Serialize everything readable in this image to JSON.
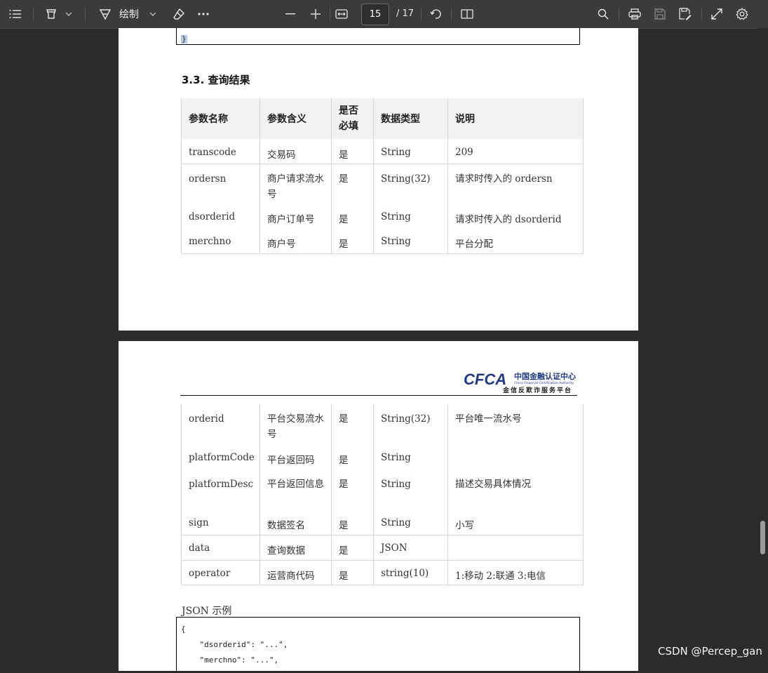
{
  "toolbar": {
    "draw_label": "绘制",
    "page_current": "15",
    "page_total": "/ 17"
  },
  "page1": {
    "brace": "}",
    "section_title": "3.3. 查询结果",
    "headers": [
      "参数名称",
      "参数含义",
      "是否必填",
      "数据类型",
      "说明"
    ],
    "rows": [
      [
        "transcode",
        "交易码",
        "是",
        "String",
        "209"
      ],
      [
        "ordersn",
        "商户请求流水号",
        "是",
        "String(32)",
        "请求时传入的 ordersn"
      ],
      [
        "dsorderid",
        "商户订单号",
        "是",
        "String",
        "请求时传入的 dsorderid"
      ],
      [
        "merchno",
        "商户号",
        "是",
        "String",
        "平台分配"
      ]
    ]
  },
  "page2": {
    "logo_text": "CFCA",
    "logo_cn": "中国金融认证中心",
    "logo_en": "China Financial Certification Authority",
    "logo_sub": "金信反欺诈服务平台",
    "rows": [
      [
        "orderid",
        "平台交易流水号",
        "是",
        "String(32)",
        "平台唯一流水号"
      ],
      [
        "platformCode",
        "平台返回码",
        "是",
        "String",
        ""
      ],
      [
        "platformDesc",
        "平台返回信息",
        "是",
        "String",
        "描述交易具体情况"
      ],
      [
        "sign",
        "数据签名",
        "是",
        "String",
        "小写"
      ],
      [
        "data",
        "查询数据",
        "是",
        "JSON",
        ""
      ],
      [
        "operator",
        "运营商代码",
        "是",
        "string(10)",
        "1:移动 2:联通 3:电信"
      ]
    ],
    "json_label": "JSON 示例",
    "json_lines": [
      "{",
      "    \"dsorderid\": \"...\",",
      "    \"merchno\": \"...\","
    ]
  },
  "watermark": "CSDN @Percep_gan"
}
